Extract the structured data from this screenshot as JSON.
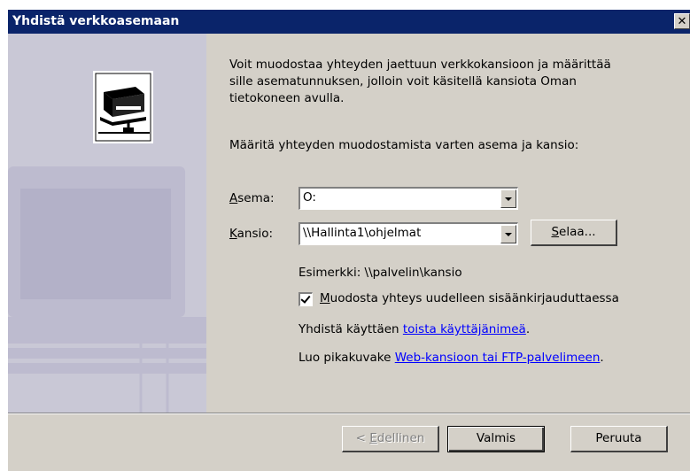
{
  "window": {
    "title": "Yhdistä verkkoasemaan",
    "close_glyph": "✕"
  },
  "description": "Voit muodostaa yhteyden jaettuun verkkokansioon ja määrittää sille asematunnuksen, jolloin voit käsitellä kansiota Oman tietokoneen avulla.",
  "instruction": "Määritä yhteyden muodostamista varten asema ja kansio:",
  "drive": {
    "label_accel": "A",
    "label_rest": "sema:",
    "value": "O:"
  },
  "folder": {
    "label_accel": "K",
    "label_rest": "ansio:",
    "value": "\\\\Hallinta1\\ohjelmat",
    "browse_accel": "S",
    "browse_rest": "elaa..."
  },
  "example": "Esimerkki: \\\\palvelin\\kansio",
  "reconnect": {
    "accel": "M",
    "rest": "uodosta yhteys uudelleen sisäänkirjauduttaessa",
    "checked": true
  },
  "connect_as": {
    "prefix": "Yhdistä käyttäen ",
    "link": "toista käyttäjänimeä",
    "suffix": "."
  },
  "shortcut": {
    "prefix": "Luo pikakuvake ",
    "link": "Web-kansioon tai FTP-palvelimeen",
    "suffix": "."
  },
  "buttons": {
    "back_prefix": "< ",
    "back_accel": "E",
    "back_rest": "dellinen",
    "finish": "Valmis",
    "cancel": "Peruuta"
  },
  "icons": {
    "network_drive": "network-drive-icon",
    "side_art": "computer-watermark-icon"
  },
  "colors": {
    "titlebar": "#0a246a",
    "side_panel": "#c9c8d6",
    "link": "#0000ff"
  }
}
